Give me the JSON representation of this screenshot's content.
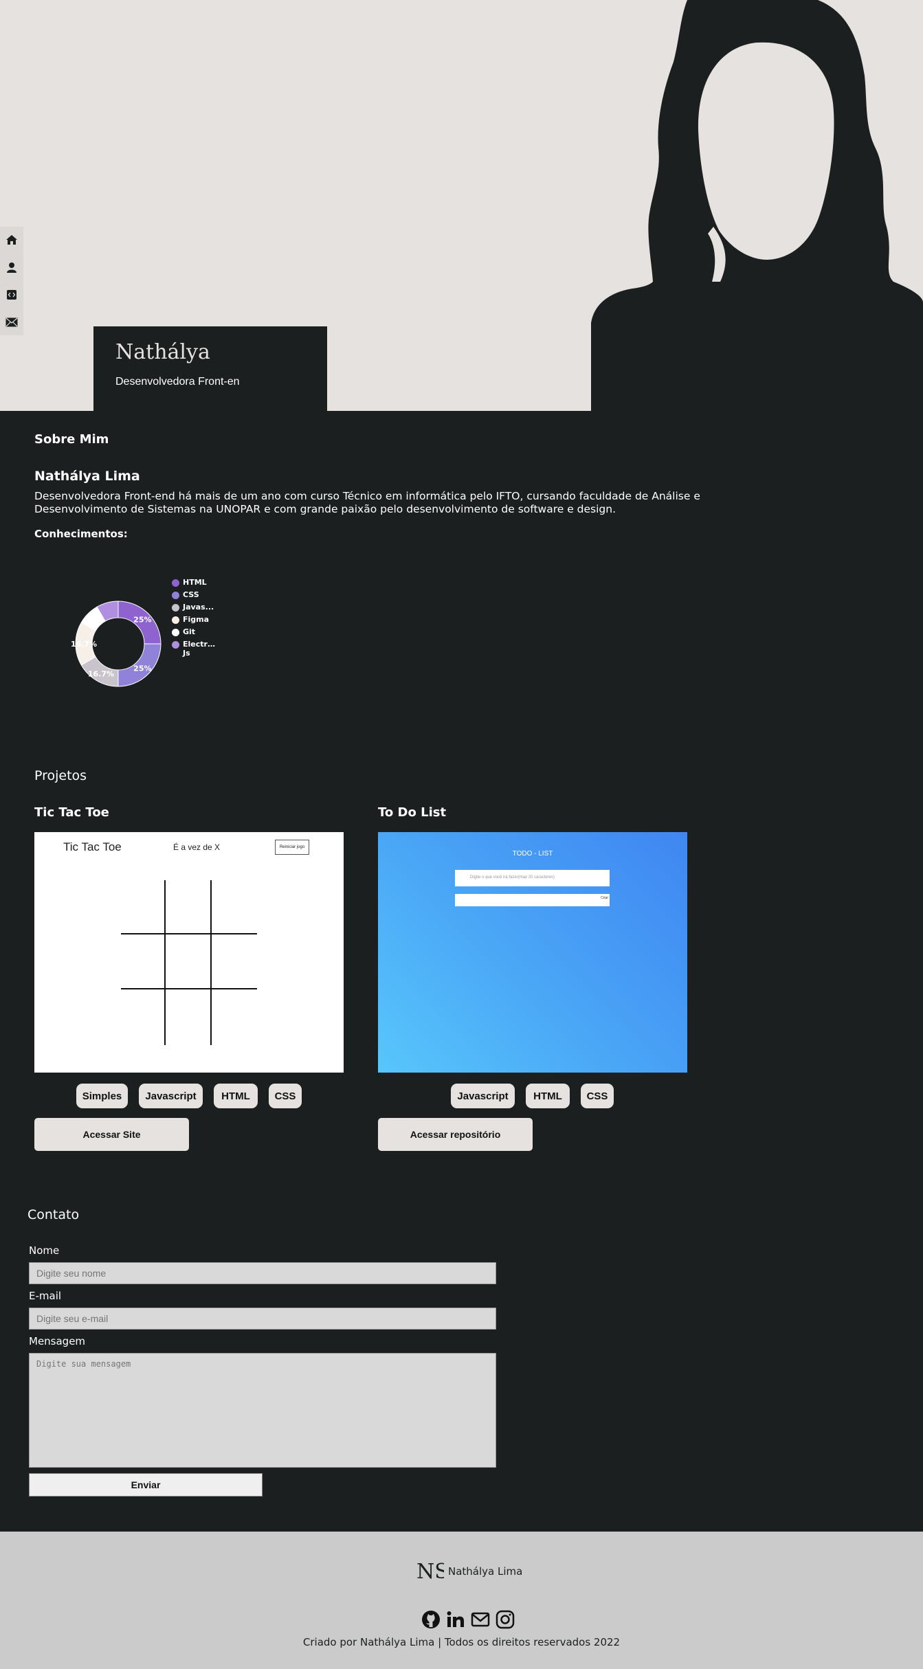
{
  "side_nav": {
    "items": [
      {
        "icon": "home-icon"
      },
      {
        "icon": "user-icon"
      },
      {
        "icon": "code-icon"
      },
      {
        "icon": "mail-icon"
      }
    ]
  },
  "hero": {
    "name": "Nathálya",
    "role": "Desenvolvedora Front-en"
  },
  "about": {
    "title": "Sobre Mim",
    "name": "Nathálya Lima",
    "text": "Desenvolvedora Front-end há mais de um ano com curso Técnico em informática pelo IFTO, cursando faculdade de Análise e Desenvolvimento de Sistemas na UNOPAR e com grande paixão pelo desenvolvimento de software e design.",
    "skills_title": "Conhecimentos:"
  },
  "chart_data": {
    "type": "pie",
    "variant": "doughnut",
    "legend_position": "right",
    "categories": [
      "HTML",
      "CSS",
      "Javas...",
      "Figma",
      "Git",
      "Electron Js"
    ],
    "values": [
      25,
      25,
      16.7,
      16.7,
      8.3,
      8.3
    ],
    "data_labels": [
      "25%",
      "25%",
      "16.7%",
      "16.7%",
      "",
      ""
    ],
    "colors": [
      "#8e63cf",
      "#8f82d8",
      "#c9c4cc",
      "#f6f0e8",
      "#ffffff",
      "#b08ee0"
    ]
  },
  "projects": {
    "title": "Projetos",
    "items": [
      {
        "title": "Tic Tac Toe",
        "preview": {
          "heading": "Tic Tac Toe",
          "turn": "É a vez de X",
          "button": "Reiniciar jogo"
        },
        "tags": [
          "Simples",
          "Javascript",
          "HTML",
          "CSS"
        ],
        "cta": "Acessar Site"
      },
      {
        "title": "To Do List",
        "preview": {
          "heading": "TODO - LIST",
          "placeholder": "Digite o que você irá fazer(max 20 caracteres)",
          "button": "Criar"
        },
        "tags": [
          "Javascript",
          "HTML",
          "CSS"
        ],
        "cta": "Acessar repositório"
      }
    ]
  },
  "contact": {
    "title": "Contato",
    "name_label": "Nome",
    "name_placeholder": "Digite seu nome",
    "email_label": "E-mail",
    "email_placeholder": "Digite seu e-mail",
    "message_label": "Mensagem",
    "message_placeholder": "Digite sua mensagem",
    "submit": "Enviar"
  },
  "footer": {
    "logo_text": "NS",
    "brand": "Nathálya Lima",
    "social": [
      {
        "icon": "github-icon"
      },
      {
        "icon": "linkedin-icon"
      },
      {
        "icon": "email-icon"
      },
      {
        "icon": "instagram-icon"
      }
    ],
    "copyright": "Criado por Nathálya Lima | Todos os direitos reservados 2022"
  }
}
